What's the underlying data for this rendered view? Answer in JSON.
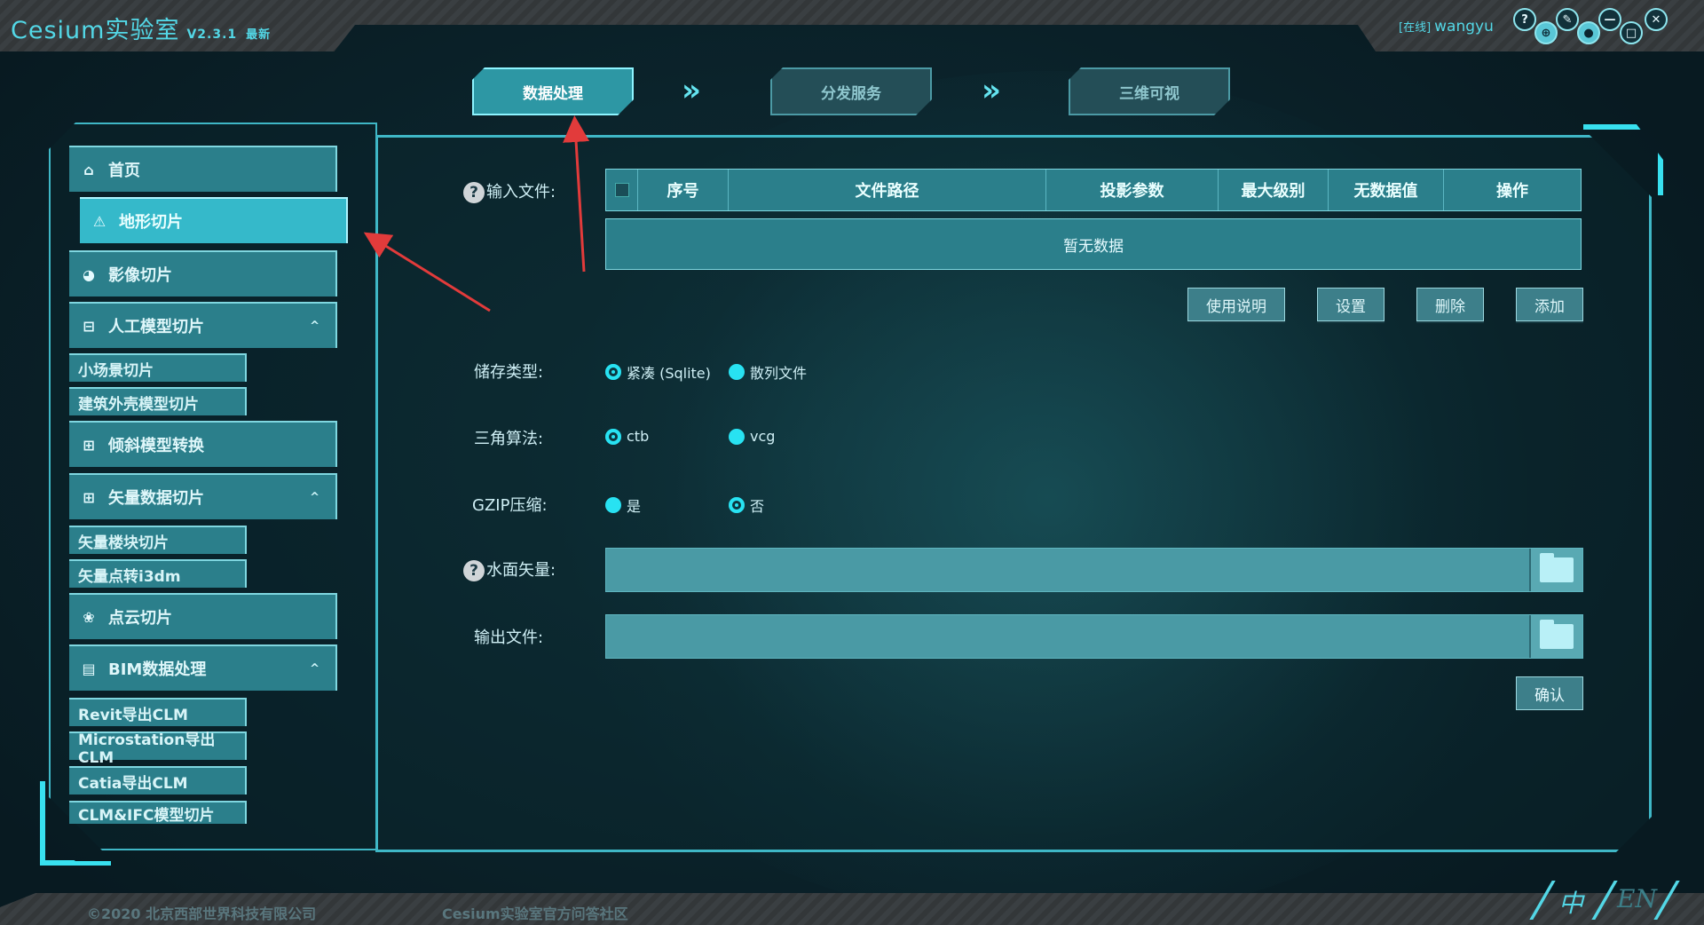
{
  "header": {
    "app_title": "Cesium实验室",
    "version": "V2.3.1",
    "latest_badge": "最新",
    "user_status": "[在线]",
    "user_name": "wangyu"
  },
  "window_controls": [
    {
      "icon": "help-icon",
      "glyph": "?"
    },
    {
      "icon": "globe-icon",
      "glyph": "⊕"
    },
    {
      "icon": "wrench-icon",
      "glyph": "✎"
    },
    {
      "icon": "user-icon",
      "glyph": "●"
    },
    {
      "icon": "minimize-icon",
      "glyph": "—"
    },
    {
      "icon": "maximize-icon",
      "glyph": "□"
    },
    {
      "icon": "close-icon",
      "glyph": "✕"
    }
  ],
  "steps": [
    {
      "label": "数据处理",
      "state": "active"
    },
    {
      "label": "分发服务",
      "state": "inactive"
    },
    {
      "label": "三维可视",
      "state": "inactive"
    }
  ],
  "step_separator": "»",
  "nav": {
    "home": {
      "label": "首页",
      "icon": "home-icon"
    },
    "terrain": {
      "label": "地形切片",
      "icon": "terrain-icon"
    },
    "imagery": {
      "label": "影像切片",
      "icon": "imagery-icon"
    },
    "manual_model": {
      "label": "人工模型切片",
      "icon": "model-icon"
    },
    "manual_model_subs": [
      "小场景切片",
      "建筑外壳模型切片"
    ],
    "oblique": {
      "label": "倾斜模型转换",
      "icon": "oblique-icon"
    },
    "vector": {
      "label": "矢量数据切片",
      "icon": "vector-icon"
    },
    "vector_subs": [
      "矢量楼块切片",
      "矢量点转i3dm"
    ],
    "pointcloud": {
      "label": "点云切片",
      "icon": "pointcloud-icon"
    },
    "bim": {
      "label": "BIM数据处理",
      "icon": "bim-icon"
    },
    "bim_subs": [
      "Revit导出CLM",
      "Microstation导出CLM",
      "Catia导出CLM",
      "CLM&IFC模型切片"
    ],
    "caret": "^"
  },
  "form": {
    "input_file_label": "输入文件:",
    "help_glyph": "?",
    "table_headers": [
      "序号",
      "文件路径",
      "投影参数",
      "最大级别",
      "无数据值",
      "操作"
    ],
    "table_empty": "暂无数据",
    "buttons": {
      "usage": "使用说明",
      "settings": "设置",
      "delete": "删除",
      "add": "添加"
    },
    "storage_label": "储存类型:",
    "storage_options": [
      "紧凑 (Sqlite)",
      "散列文件"
    ],
    "triangle_label": "三角算法:",
    "triangle_options": [
      "ctb",
      "vcg"
    ],
    "gzip_label": "GZIP压缩:",
    "gzip_options": [
      "是",
      "否"
    ],
    "water_label": "水面矢量:",
    "water_value": "",
    "output_label": "输出文件:",
    "output_value": "",
    "confirm": "确认"
  },
  "footer": {
    "copyright": "©2020 北京西部世界科技有限公司",
    "community": "Cesium实验室官方问答社区",
    "lang_zh": "中",
    "lang_en": "EN"
  },
  "colors": {
    "accent": "#53d7e6",
    "panel_border": "#3fb7c6",
    "annotation_arrow": "#e23b3b"
  }
}
